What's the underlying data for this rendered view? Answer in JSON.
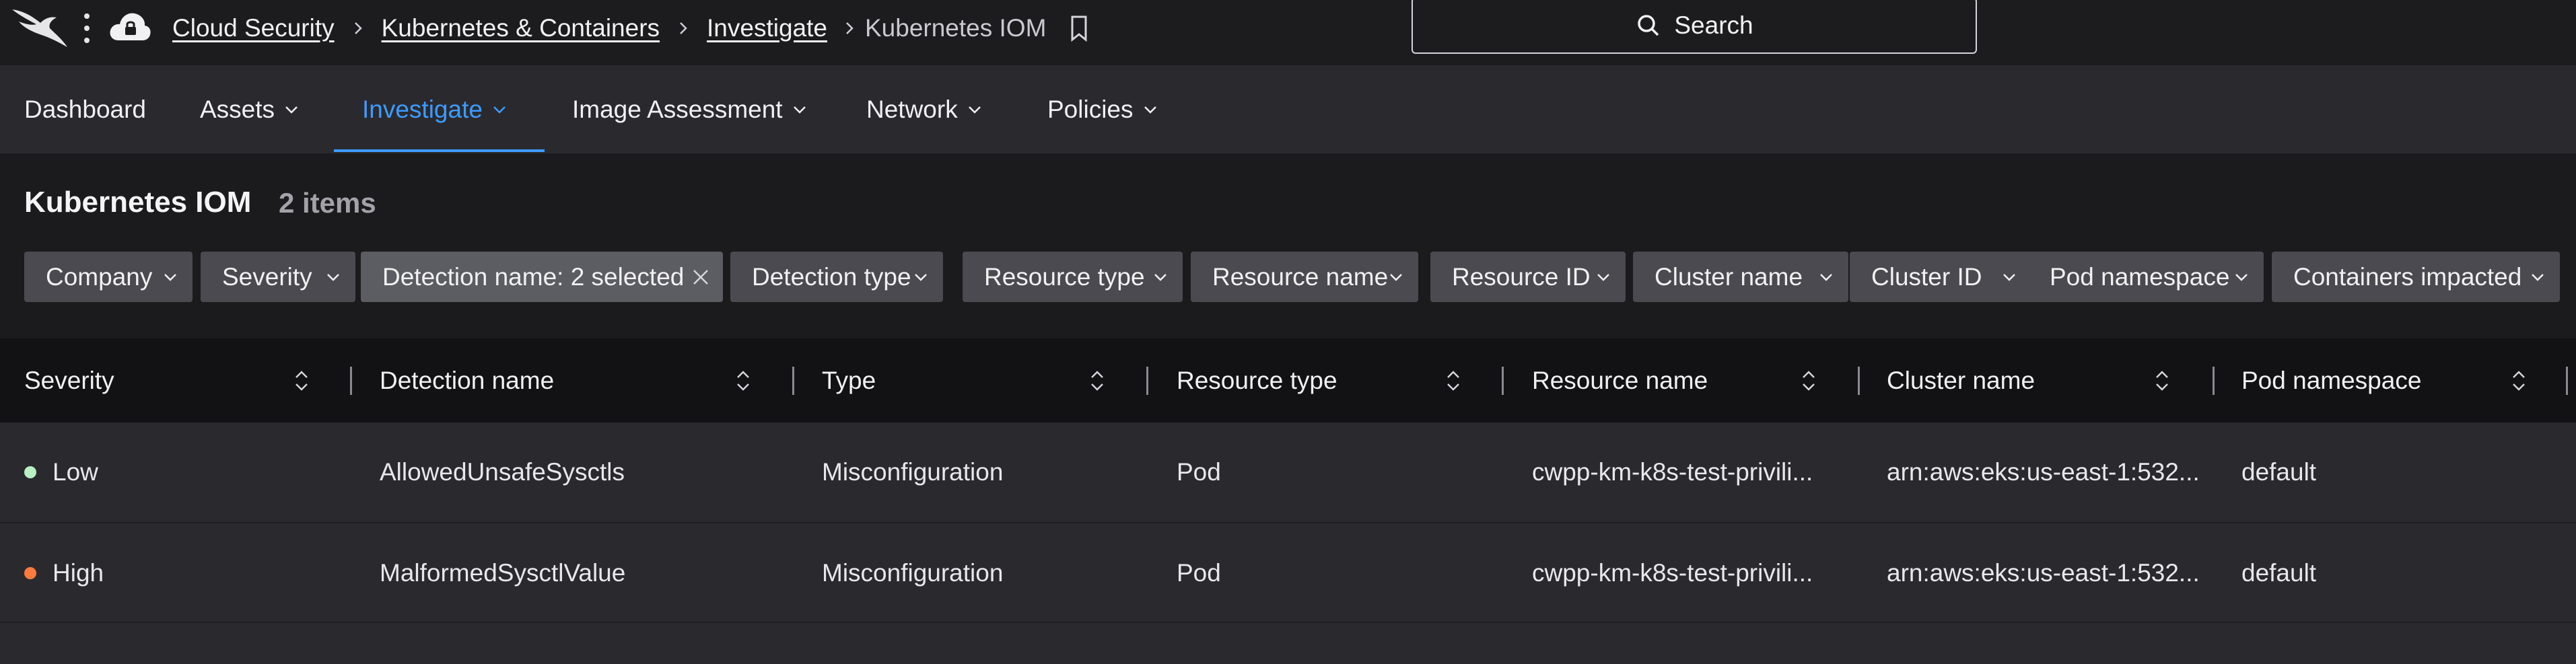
{
  "breadcrumb": {
    "items": [
      "Cloud Security",
      "Kubernetes & Containers",
      "Investigate"
    ],
    "current": "Kubernetes IOM"
  },
  "search": {
    "label": "Search"
  },
  "nav": {
    "items": [
      "Dashboard",
      "Assets",
      "Investigate",
      "Image Assessment",
      "Network",
      "Policies"
    ],
    "active": "Investigate",
    "accent_color": "#3d9bff"
  },
  "page": {
    "title": "Kubernetes IOM",
    "count": "2 items"
  },
  "filters": [
    "Company",
    "Severity",
    "Detection name: 2 selected",
    "Detection type",
    "Resource type",
    "Resource name",
    "Resource ID",
    "Cluster name",
    "Cluster ID",
    "Pod namespace",
    "Containers impacted"
  ],
  "table": {
    "columns": [
      "Severity",
      "Detection name",
      "Type",
      "Resource type",
      "Resource name",
      "Cluster name",
      "Pod namespace"
    ],
    "rows": [
      {
        "severity": "Low",
        "severity_color": "#b9f0c4",
        "detection": "AllowedUnsafeSysctls",
        "type": "Misconfiguration",
        "resource_type": "Pod",
        "resource_name": "cwpp-km-k8s-test-privili...",
        "cluster": "arn:aws:eks:us-east-1:532...",
        "namespace": "default"
      },
      {
        "severity": "High",
        "severity_color": "#ff7a3d",
        "detection": "MalformedSysctlValue",
        "type": "Misconfiguration",
        "resource_type": "Pod",
        "resource_name": "cwpp-km-k8s-test-privili...",
        "cluster": "arn:aws:eks:us-east-1:532...",
        "namespace": "default"
      }
    ]
  }
}
